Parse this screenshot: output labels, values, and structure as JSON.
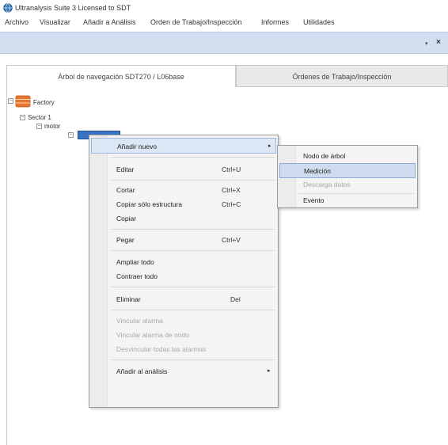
{
  "window": {
    "title": "Ultranalysis Suite 3 Licensed to SDT"
  },
  "menubar": {
    "items": [
      "Archivo",
      "Visualizar",
      "Añadir a Análisis",
      "Orden de Trabajo/Inspección",
      "Informes",
      "Utilidades"
    ]
  },
  "tabs": {
    "nav_label": "Árbol de navegación SDT270 / L06base",
    "orders_label": "Órdenes de Trabajo/Inspección"
  },
  "tree": {
    "root": "Factory",
    "sector": "Sector 1",
    "machine": "motor",
    "selected": "",
    "expanders": [
      "−",
      "−",
      "−",
      "−"
    ]
  },
  "context_menu": {
    "add_new": "Añadir nuevo",
    "edit": "Editar",
    "edit_shortcut": "Ctrl+U",
    "cut": "Cortar",
    "cut_shortcut": "Ctrl+X",
    "copy_structure": "Copiar sólo estructura",
    "copy_structure_shortcut": "Ctrl+C",
    "copy": "Copiar",
    "paste": "Pegar",
    "paste_shortcut": "Ctrl+V",
    "expand_all": "Ampliar todo",
    "collapse_all": "Contraer todo",
    "delete": "Eliminar",
    "delete_shortcut": "Del",
    "link_alarm": "Vincular alarma",
    "link_node_alarm": "Vincular alarma de nodo",
    "unlink_alarms": "Desvincular todas las alarmas",
    "add_to_analysis": "Añadir al análisis",
    "arrow": "▸"
  },
  "submenu": {
    "tree_node": "Nodo de árbol",
    "measurement": "Medición",
    "download_data": "Descarga datos",
    "event": "Evento"
  },
  "icons": {
    "app": "app-globe-icon",
    "database": "database-icon",
    "pin": "pin-icon",
    "close": "close-icon"
  },
  "colors": {
    "accent_bar": "#d1dff0",
    "selection": "#3b73c4",
    "highlight": "#cfdcef"
  },
  "window_controls": {
    "pin": "▾",
    "close": "×"
  }
}
